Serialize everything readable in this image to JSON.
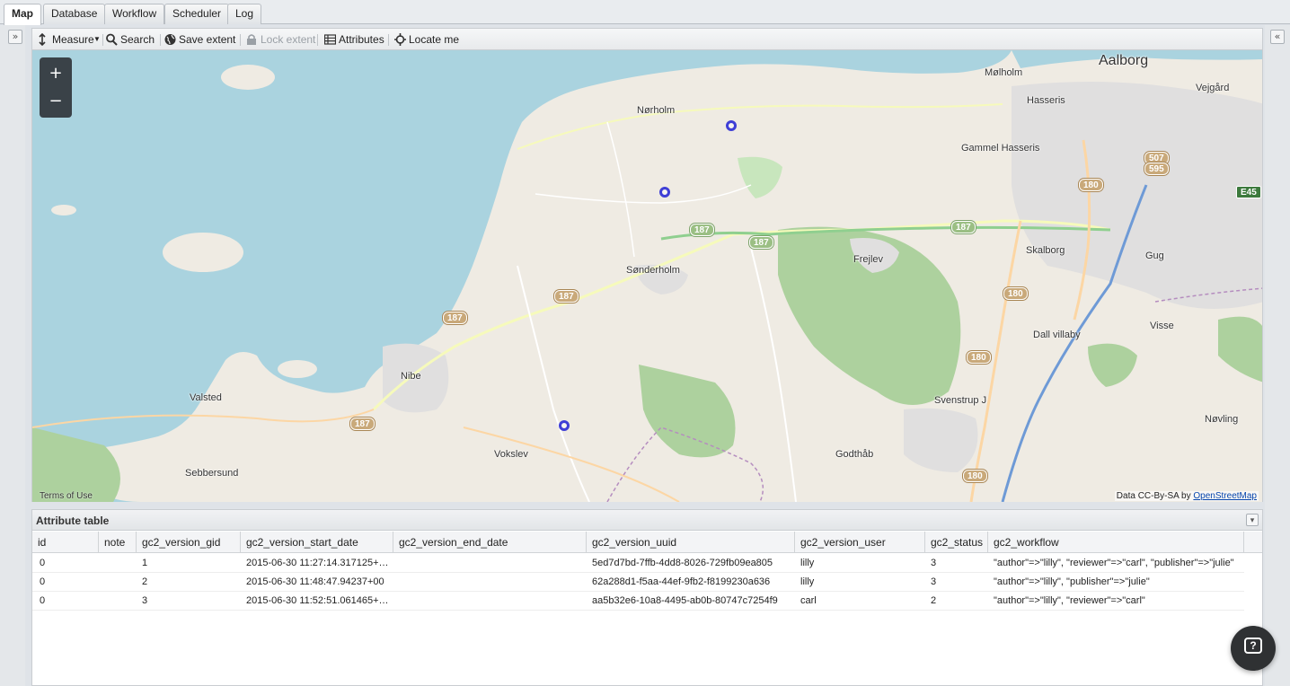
{
  "tabs": [
    {
      "label": "Map",
      "active": true
    },
    {
      "label": "Database"
    },
    {
      "label": "Workflow"
    },
    {
      "label": "Scheduler"
    },
    {
      "label": "Log"
    }
  ],
  "toolbar": {
    "measure": "Measure",
    "search": "Search",
    "save_extent": "Save extent",
    "lock_extent": "Lock extent",
    "attributes": "Attributes",
    "locate_me": "Locate me"
  },
  "map": {
    "zoom_in": "+",
    "zoom_out": "−",
    "places": {
      "aalborg": "Aalborg",
      "molholm": "Mølholm",
      "vejgaard": "Vejgård",
      "hasseris": "Hasseris",
      "gammel_hasseris": "Gammel Hasseris",
      "norholm": "Nørholm",
      "sonderholm": "Sønderholm",
      "frejlev": "Frejlev",
      "skalborg": "Skalborg",
      "gug": "Gug",
      "nibe": "Nibe",
      "valsted": "Valsted",
      "sebbersund": "Sebbersund",
      "vokslev": "Vokslev",
      "dall_villaby": "Dall villaby",
      "visse": "Visse",
      "svenstrup": "Svenstrup J",
      "godthaab": "Godthåb",
      "novling": "Nøvling"
    },
    "road_labels": {
      "r187": "187",
      "r180": "180",
      "r507": "507",
      "r595": "595",
      "e45": "E45"
    },
    "terms": "Terms of Use",
    "attribution_prefix": "Data CC-By-SA by",
    "attribution_link": "OpenStreetMap"
  },
  "attribute_table": {
    "title": "Attribute table",
    "columns": [
      "id",
      "note",
      "gc2_version_gid",
      "gc2_version_start_date",
      "gc2_version_end_date",
      "gc2_version_uuid",
      "gc2_version_user",
      "gc2_status",
      "gc2_workflow"
    ],
    "rows": [
      [
        "0",
        "",
        "1",
        "2015-06-30 11:27:14.317125+…",
        "",
        "5ed7d7bd-7ffb-4dd8-8026-729fb09ea805",
        "lilly",
        "3",
        "\"author\"=>\"lilly\", \"reviewer\"=>\"carl\", \"publisher\"=>\"julie\""
      ],
      [
        "0",
        "",
        "2",
        "2015-06-30 11:48:47.94237+00",
        "",
        "62a288d1-f5aa-44ef-9fb2-f8199230a636",
        "lilly",
        "3",
        "\"author\"=>\"lilly\", \"publisher\"=>\"julie\""
      ],
      [
        "0",
        "",
        "3",
        "2015-06-30 11:52:51.061465+…",
        "",
        "aa5b32e6-10a8-4495-ab0b-80747c7254f9",
        "carl",
        "2",
        "\"author\"=>\"lilly\", \"reviewer\"=>\"carl\""
      ]
    ]
  },
  "help": {
    "label": "?"
  }
}
